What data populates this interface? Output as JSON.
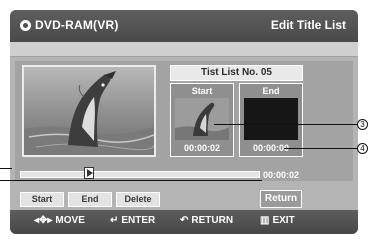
{
  "header": {
    "title_left": "DVD-RAM(VR)",
    "title_right": "Edit Title List"
  },
  "list": {
    "title": "Tist List No. 05"
  },
  "thumbs": {
    "start": {
      "label": "Start",
      "time": "00:00:02"
    },
    "end": {
      "label": "End",
      "time": "00:00:00"
    }
  },
  "playback": {
    "current_time": "00:00:02",
    "progress_fraction": 0.28
  },
  "buttons": {
    "start": "Start",
    "end": "End",
    "delete": "Delete",
    "return": "Return"
  },
  "nav": {
    "move": "MOVE",
    "move_icon": "move-icon",
    "enter": "ENTER",
    "enter_icon": "enter-icon",
    "return": "RETURN",
    "return_icon": "return-icon",
    "exit": "EXIT",
    "exit_icon": "exit-icon"
  },
  "callouts": {
    "c3": "3",
    "c4": "4"
  }
}
